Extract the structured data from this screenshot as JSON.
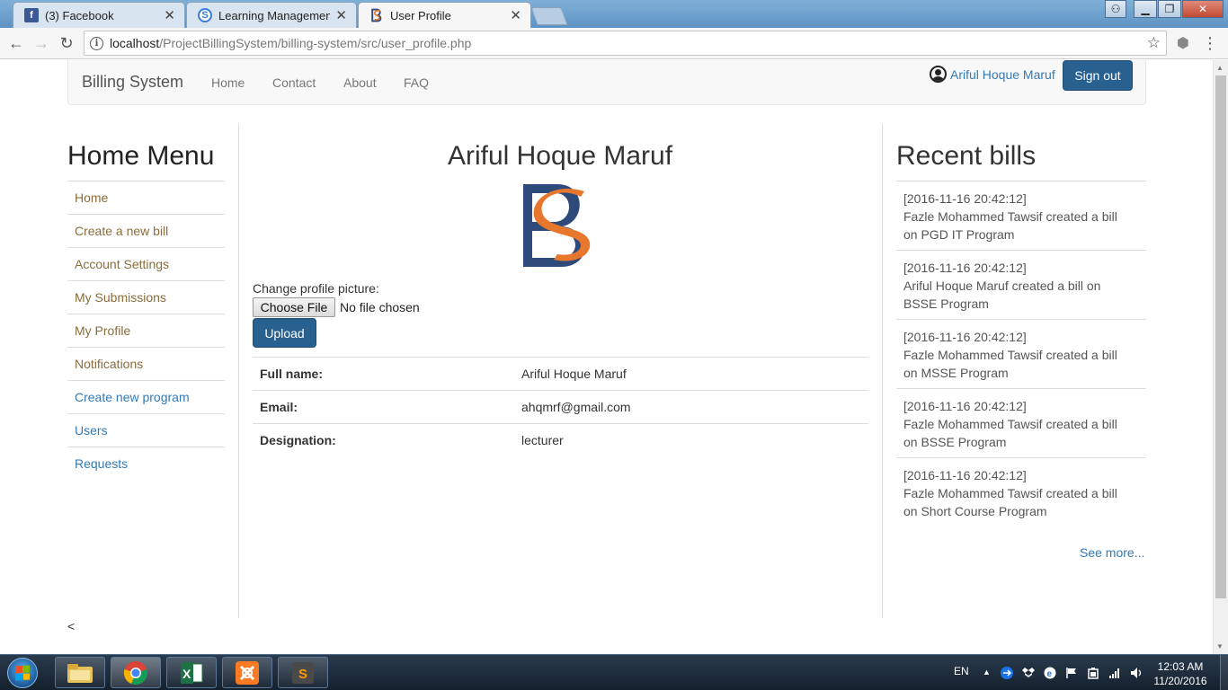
{
  "browser": {
    "tabs": [
      {
        "label": "(3) Facebook",
        "icon": "facebook-icon",
        "active": false
      },
      {
        "label": "Learning Management Sy",
        "icon": "lms-icon",
        "active": false
      },
      {
        "label": "User Profile",
        "icon": "bs-logo-icon",
        "active": true
      }
    ],
    "url_host": "localhost",
    "url_path": "/ProjectBillingSystem/billing-system/src/user_profile.php"
  },
  "navbar": {
    "brand": "Billing System",
    "links": [
      "Home",
      "Contact",
      "About",
      "FAQ"
    ],
    "user_name": "Ariful Hoque Maruf",
    "signout_label": "Sign out"
  },
  "left_menu": {
    "title": "Home Menu",
    "items": [
      {
        "label": "Home",
        "color": "#8a6d3b"
      },
      {
        "label": "Create a new bill",
        "color": "#8a6d3b"
      },
      {
        "label": "Account Settings",
        "color": "#8a6d3b"
      },
      {
        "label": "My Submissions",
        "color": "#8a6d3b"
      },
      {
        "label": "My Profile",
        "color": "#8a6d3b"
      },
      {
        "label": "Notifications",
        "color": "#8a6d3b"
      },
      {
        "label": "Create new program",
        "color": "#337ab7"
      },
      {
        "label": "Users",
        "color": "#337ab7"
      },
      {
        "label": "Requests",
        "color": "#337ab7"
      }
    ]
  },
  "profile": {
    "name": "Ariful Hoque Maruf",
    "change_picture_label": "Change profile picture:",
    "choose_file_label": "Choose File",
    "no_file_text": "No file chosen",
    "upload_label": "Upload",
    "fields": [
      {
        "label": "Full name:",
        "value": "Ariful Hoque Maruf"
      },
      {
        "label": "Email:",
        "value": "ahqmrf@gmail.com"
      },
      {
        "label": "Designation:",
        "value": "lecturer"
      }
    ]
  },
  "recent_bills": {
    "title": "Recent bills",
    "items": [
      {
        "timestamp": "[2016-11-16 20:42:12]",
        "line1": "Fazle Mohammed Tawsif created a bill",
        "line2": "on PGD IT Program"
      },
      {
        "timestamp": "[2016-11-16 20:42:12]",
        "line1": "Ariful Hoque Maruf created a bill on",
        "line2": "BSSE Program"
      },
      {
        "timestamp": "[2016-11-16 20:42:12]",
        "line1": "Fazle Mohammed Tawsif created a bill",
        "line2": "on MSSE Program"
      },
      {
        "timestamp": "[2016-11-16 20:42:12]",
        "line1": "Fazle Mohammed Tawsif created a bill",
        "line2": "on BSSE Program"
      },
      {
        "timestamp": "[2016-11-16 20:42:12]",
        "line1": "Fazle Mohammed Tawsif created a bill",
        "line2": "on Short Course Program"
      }
    ],
    "see_more_label": "See more..."
  },
  "footer": {
    "text": "<"
  },
  "taskbar": {
    "language": "EN",
    "time": "12:03 AM",
    "date": "11/20/2016"
  },
  "colors": {
    "logo_blue": "#2e4a7a",
    "logo_orange": "#e8772e",
    "primary_button": "#286090",
    "link": "#337ab7"
  }
}
